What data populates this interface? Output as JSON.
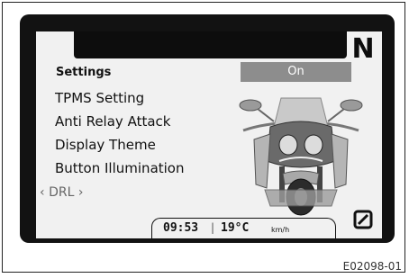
{
  "gear_indicator": "N",
  "menu": {
    "title": "Settings",
    "items": [
      "TPMS Setting",
      "Anti Relay Attack",
      "Display Theme",
      "Button Illumination"
    ],
    "current_item": "DRL",
    "left_arrow": "‹",
    "right_arrow": "›"
  },
  "value_box": {
    "label": "On"
  },
  "status_bar": {
    "time": "09:53",
    "separator": "|",
    "temperature": "19°C",
    "speed_unit": "km/h"
  },
  "trip_reset_icon": "zero-icon",
  "figure_ref": "E02098-01",
  "colors": {
    "screen": "#f1f1f1",
    "bezel": "#121212",
    "value_box": "#8d8d8d"
  }
}
